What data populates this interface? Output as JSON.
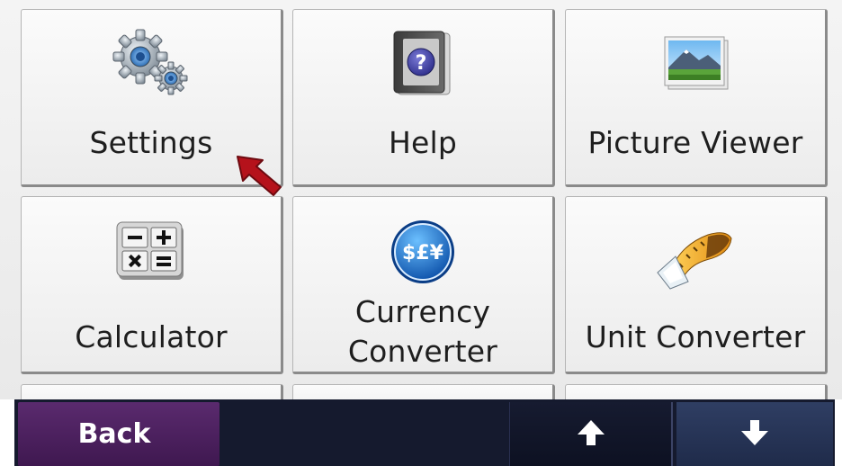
{
  "menu": {
    "items": [
      {
        "label": "Settings",
        "icon": "gear-icon"
      },
      {
        "label": "Help",
        "icon": "help-book-icon"
      },
      {
        "label": "Picture Viewer",
        "icon": "photo-icon"
      },
      {
        "label": "Calculator",
        "icon": "calculator-icon"
      },
      {
        "label": "Currency\nConverter",
        "icon": "currency-coin-icon"
      },
      {
        "label": "Unit Converter",
        "icon": "tape-measure-icon"
      }
    ]
  },
  "toolbar": {
    "back_label": "Back",
    "up_icon": "arrow-up-icon",
    "down_icon": "arrow-down-icon"
  },
  "colors": {
    "back_button": "#4a1f5e",
    "toolbar_bg": "#151a2e",
    "down_button": "#2a375a",
    "pointer": "#b5121b"
  }
}
